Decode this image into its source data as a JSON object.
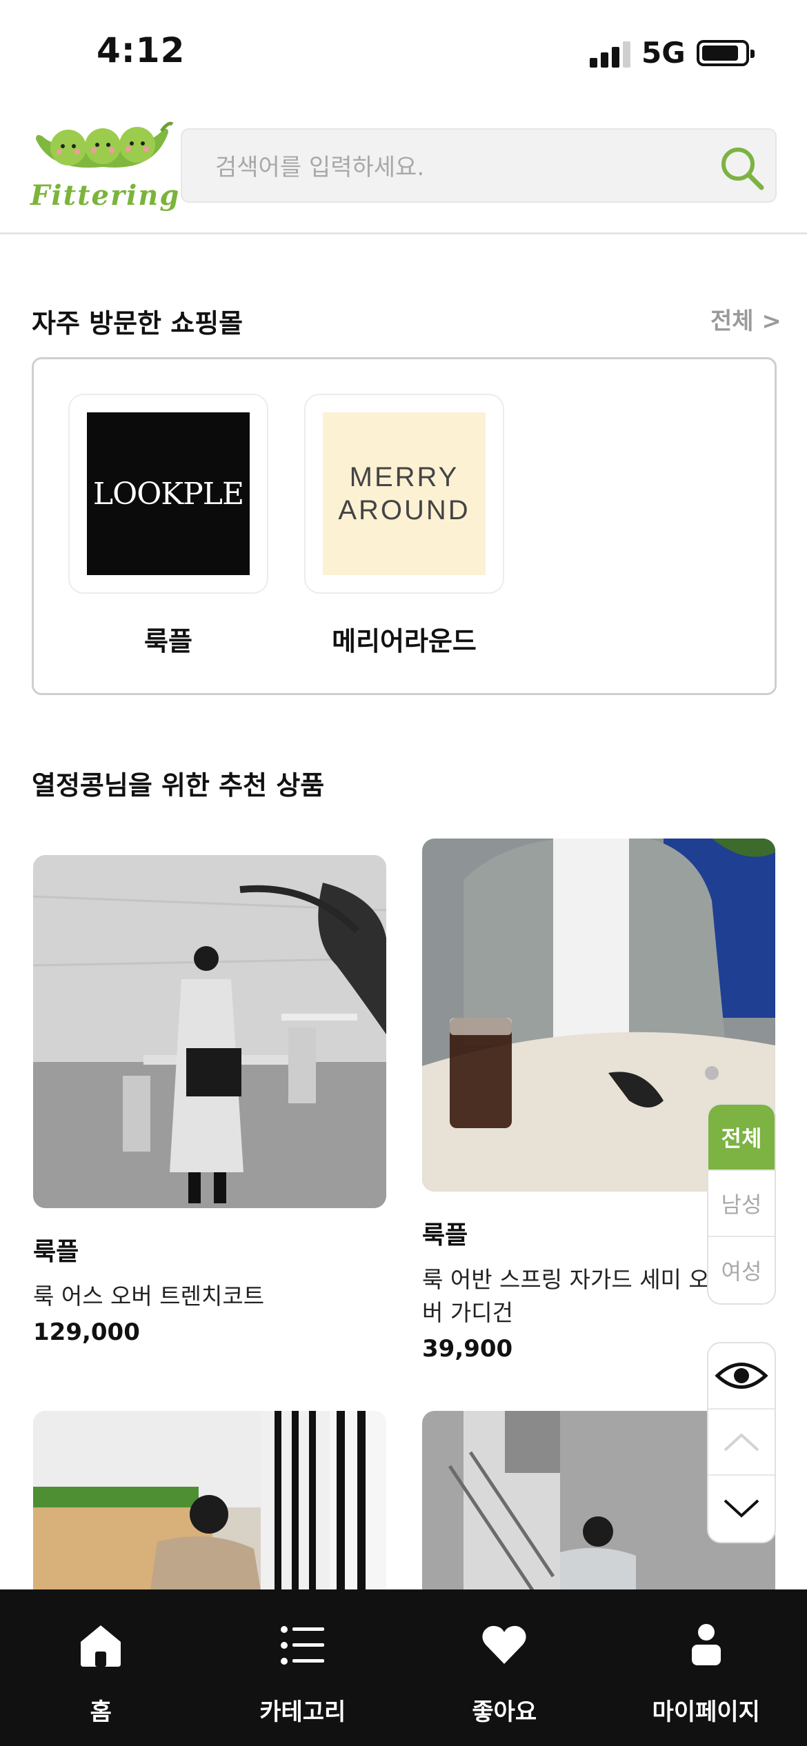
{
  "status_bar": {
    "time": "4:12",
    "network": "5G"
  },
  "header": {
    "logo_text": "Fittering",
    "search_placeholder": "검색어를 입력하세요."
  },
  "frequent_malls": {
    "title": "자주 방문한 쇼핑몰",
    "see_all": "전체 >",
    "items": [
      {
        "name": "룩플",
        "logo_text": "LOOKPLE",
        "logo_bg": "#0b0b0b",
        "logo_color": "#ffffff"
      },
      {
        "name": "메리어라운드",
        "logo_text": "MERRY AROUND",
        "logo_bg": "#fdf1d4",
        "logo_color": "#444444"
      }
    ]
  },
  "recommend": {
    "title": "열정콩님을 위한 추천 상품",
    "products": [
      {
        "brand": "룩플",
        "name": "룩 어스 오버 트렌치코트",
        "price": "129,000"
      },
      {
        "brand": "룩플",
        "name": "룩 어반 스프링 자가드 세미 오버 가디건",
        "price": "39,900"
      },
      {
        "brand": "",
        "name": "",
        "price": ""
      },
      {
        "brand": "",
        "name": "",
        "price": ""
      }
    ]
  },
  "gender_filter": {
    "options": [
      "전체",
      "남성",
      "여성"
    ],
    "selected": "전체"
  },
  "side_tools": [
    "eye-icon",
    "chevron-up-icon",
    "chevron-down-icon"
  ],
  "bottom_nav": {
    "items": [
      {
        "label": "홈",
        "icon": "home-icon"
      },
      {
        "label": "카테고리",
        "icon": "list-icon"
      },
      {
        "label": "좋아요",
        "icon": "heart-icon"
      },
      {
        "label": "마이페이지",
        "icon": "person-icon"
      }
    ]
  },
  "colors": {
    "accent": "#7cb342",
    "nav_bg": "#111111"
  }
}
